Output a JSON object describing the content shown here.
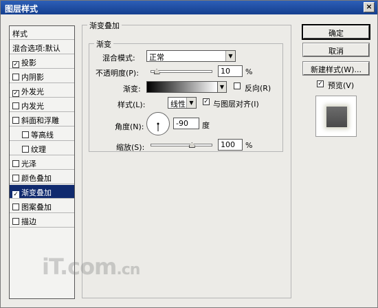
{
  "window": {
    "title": "图层样式",
    "close_glyph": "×"
  },
  "sidebar": {
    "header": "样式",
    "blend_options": "混合选项:默认",
    "items": [
      {
        "label": "投影",
        "checked": true,
        "mark": "✓"
      },
      {
        "label": "内阴影",
        "checked": false,
        "mark": ""
      },
      {
        "label": "外发光",
        "checked": true,
        "mark": "✓"
      },
      {
        "label": "内发光",
        "checked": false,
        "mark": ""
      },
      {
        "label": "斜面和浮雕",
        "checked": false,
        "mark": ""
      },
      {
        "label": "等高线",
        "checked": false,
        "mark": ""
      },
      {
        "label": "纹理",
        "checked": false,
        "mark": ""
      },
      {
        "label": "光泽",
        "checked": false,
        "mark": ""
      },
      {
        "label": "颜色叠加",
        "checked": false,
        "mark": ""
      },
      {
        "label": "渐变叠加",
        "checked": true,
        "mark": "✓",
        "selected": true
      },
      {
        "label": "图案叠加",
        "checked": false,
        "mark": ""
      },
      {
        "label": "描边",
        "checked": false,
        "mark": ""
      }
    ]
  },
  "panel": {
    "section_title": "渐变叠加",
    "group_title": "渐变",
    "blend_mode": {
      "label": "混合模式:",
      "value": "正常"
    },
    "opacity": {
      "label": "不透明度(P):",
      "value": "10",
      "unit": "%",
      "level": 0.1
    },
    "gradient": {
      "label": "渐变:",
      "reverse_label": "反向(R)",
      "reverse_checked": false
    },
    "style": {
      "label": "样式(L):",
      "value": "线性",
      "align_label": "与图层对齐(I)",
      "align_checked": true,
      "align_mark": "✓"
    },
    "angle": {
      "label": "角度(N):",
      "value": "-90",
      "unit": "度"
    },
    "scale": {
      "label": "缩放(S):",
      "value": "100",
      "unit": "%",
      "level": 0.67
    }
  },
  "buttons": {
    "ok": "确定",
    "cancel": "取消",
    "new_style": "新建样式(W)...",
    "preview_label": "预览(V)",
    "preview_mark": "✓",
    "preview_checked": true
  },
  "watermark": {
    "main": "iT.com",
    "suffix": ".cn"
  }
}
